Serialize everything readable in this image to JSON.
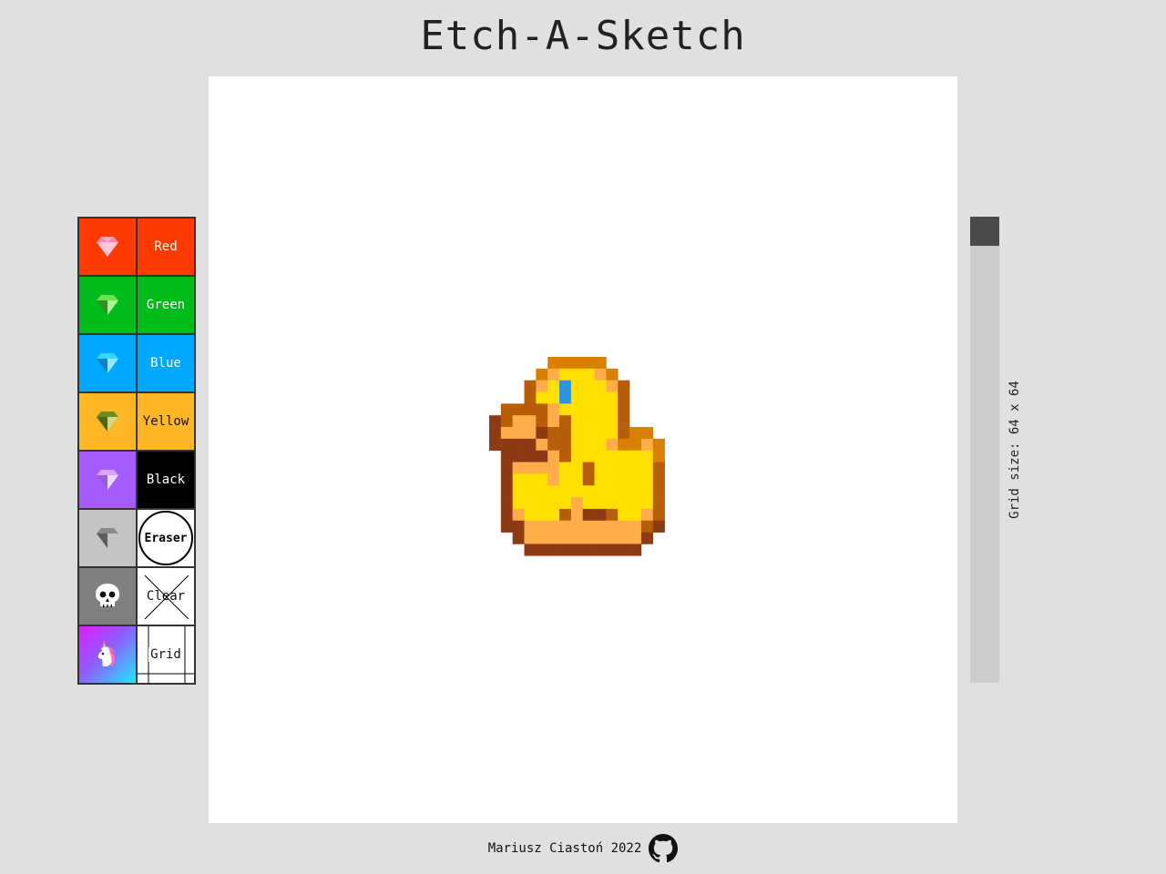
{
  "app": {
    "title": "Etch-A-Sketch"
  },
  "palette": {
    "items": [
      {
        "name": "red",
        "icon": "gem-icon",
        "label": "Red",
        "bg": "#ff3a00",
        "gem": "#ff7ea8"
      },
      {
        "name": "green",
        "icon": "gem-icon",
        "label": "Green",
        "bg": "#00bb1c",
        "gem": "#6de34b"
      },
      {
        "name": "blue",
        "icon": "gem-icon",
        "label": "Blue",
        "bg": "#00a8ff",
        "gem": "#35d7ff"
      },
      {
        "name": "yellow",
        "icon": "gem-icon",
        "label": "Yellow",
        "bg": "#ffb726",
        "gem": "#6c8c1e"
      },
      {
        "name": "black",
        "icon": "gem-icon",
        "label": "Black",
        "bg": "#a65bff",
        "gem": "#d6a6ff",
        "label_bg": "#000000"
      },
      {
        "name": "eraser",
        "icon": "gem-icon",
        "label": "Eraser",
        "bg": "#c4c4c4",
        "gem": "#8a8a8a"
      },
      {
        "name": "clear",
        "icon": "skull-icon",
        "label": "Clear",
        "bg": "#808080"
      },
      {
        "name": "grid",
        "icon": "unicorn-icon",
        "label": "Grid"
      }
    ]
  },
  "slider": {
    "value": 64,
    "min": 0,
    "max": 64
  },
  "grid_size": {
    "label": "Grid size: 64 x 64"
  },
  "footer": {
    "author": "Mariusz Ciastoń 2022",
    "icon": "github-icon"
  },
  "duck": {
    "colors": {
      "O": "#d98000",
      "L": "#ffad4a",
      "Y": "#ffe000",
      "D": "#b85e0a",
      "R": "#8e3a14",
      "B": "#2f94e0"
    },
    "rows": [
      "     OOOOO     ",
      "    OLYYYLO    ",
      "   DLYBYYYLD   ",
      "   DYYBYYYYD   ",
      " DDDDLYYYYYD   ",
      "RDLLDLDYYYYD   ",
      "RLLLRDDYYYYDOO ",
      "RRRRLDDYYYLOOLO",
      " RRRRLDYYYYYYYO",
      " RLLLLYYDYYYYYD",
      " RYYYLYYDYYYYYD",
      " RYYYYYYYYYYYYD",
      " RYYYYYLYYYYYYD",
      " RLYYYDLRRDYYLD",
      " RRLLLLLLLLLLDR",
      "  RLLLLLLLLLLR ",
      "   RRRRRRRRRR  "
    ]
  }
}
